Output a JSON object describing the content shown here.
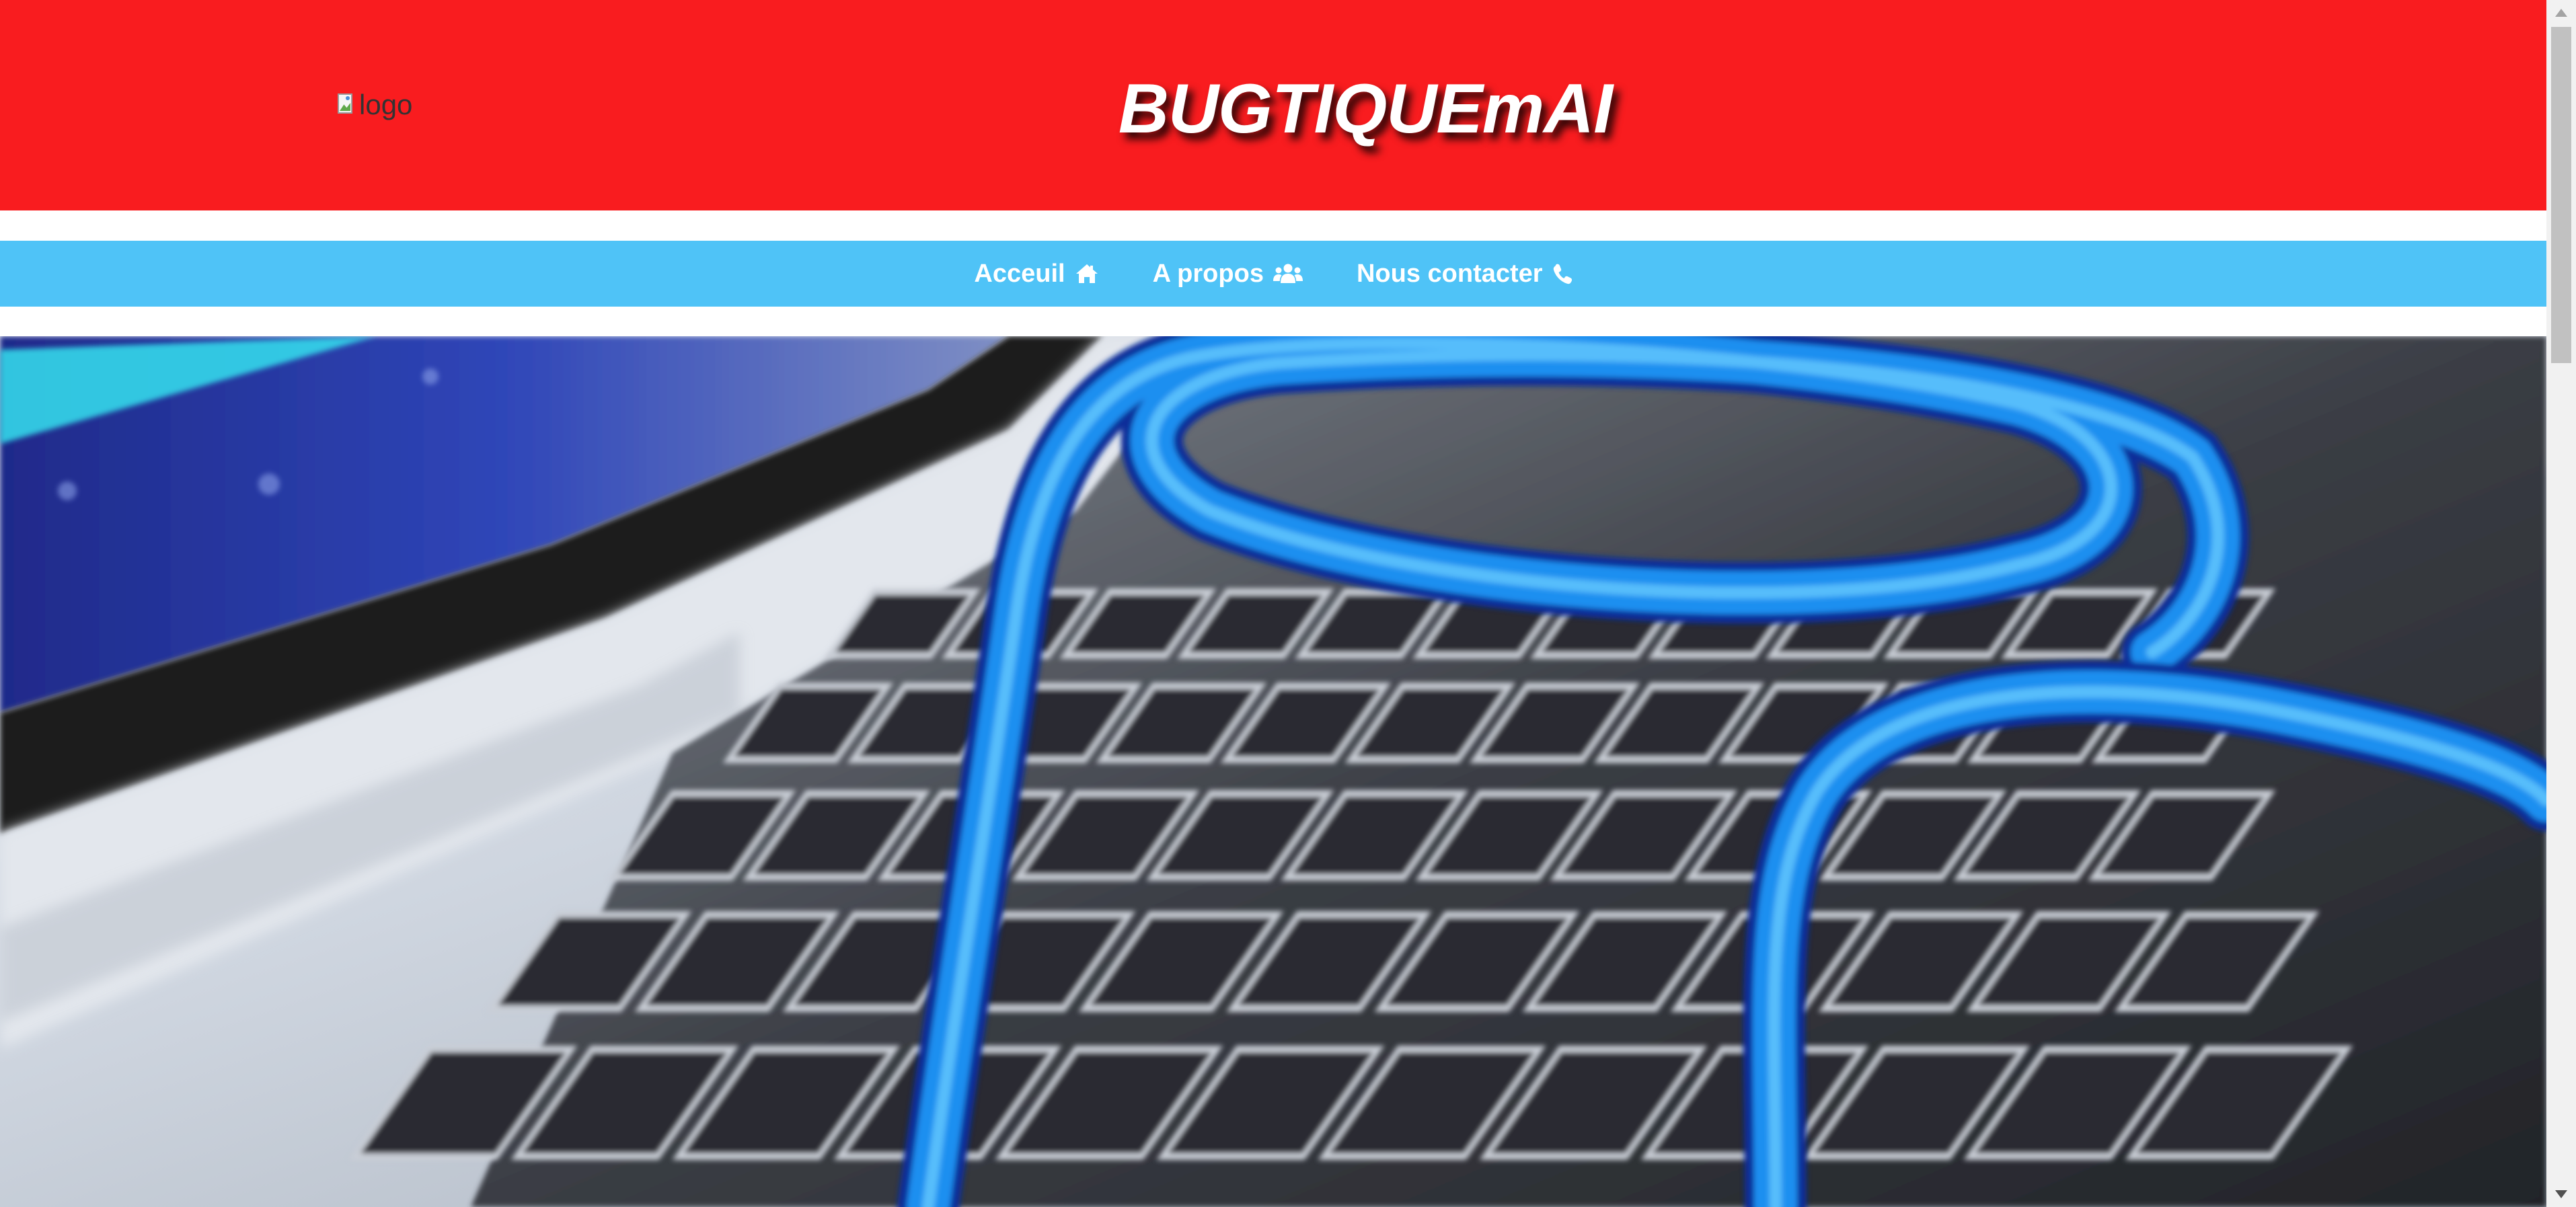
{
  "header": {
    "logo_alt": "logo",
    "title": "BUGTIQUEmAI"
  },
  "nav": {
    "items": [
      {
        "label": "Acceuil",
        "icon": "home-icon"
      },
      {
        "label": "A propos",
        "icon": "users-icon"
      },
      {
        "label": "Nous contacter",
        "icon": "phone-icon"
      }
    ]
  },
  "hero": {
    "icon": "laptop-keyboard-network-cable-photo"
  },
  "colors": {
    "header_bg": "#f91c1f",
    "nav_bg": "#4fc3f7",
    "nav_text": "#ffffff",
    "title_text": "#ffffff"
  }
}
